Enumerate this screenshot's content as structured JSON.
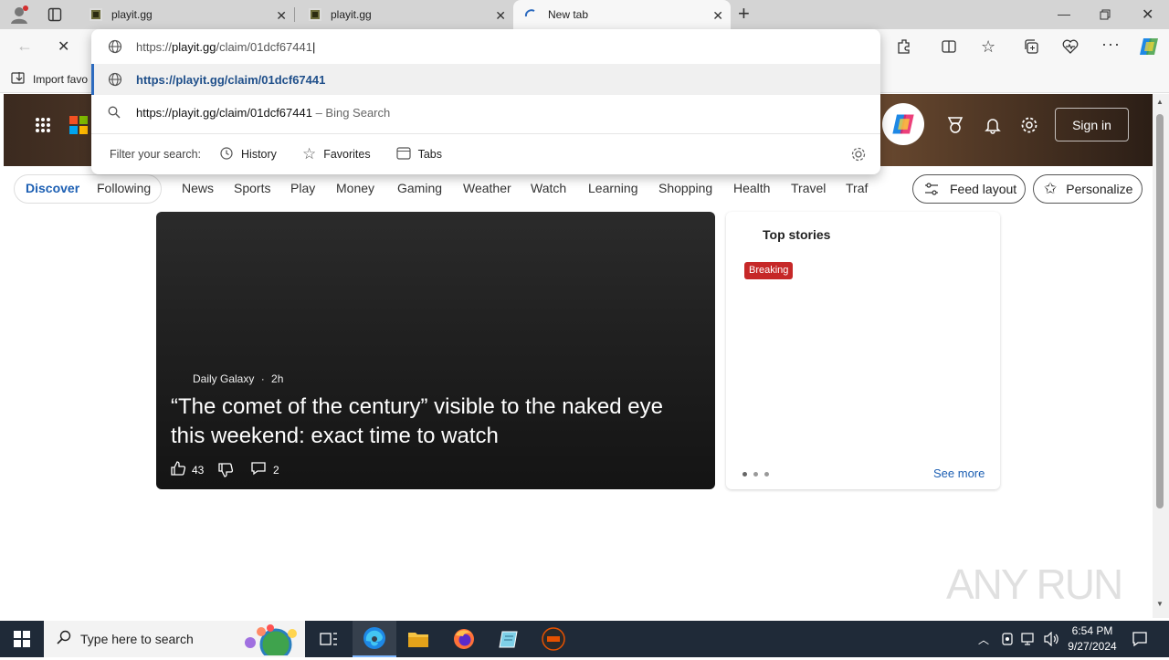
{
  "tabs": [
    {
      "title": "playit.gg"
    },
    {
      "title": "playit.gg"
    },
    {
      "title": "New tab"
    }
  ],
  "address_bar": {
    "value_prefix": "https://",
    "value_host": "playit.gg",
    "value_path": "/claim/01dcf67441"
  },
  "suggestions": [
    {
      "text": "https://playit.gg/claim/01dcf67441",
      "suffix": ""
    },
    {
      "text": "https://playit.gg/claim/01dcf67441",
      "suffix": " – Bing Search"
    }
  ],
  "filter": {
    "label": "Filter your search:",
    "options": [
      "History",
      "Favorites",
      "Tabs"
    ]
  },
  "favorites_bar": {
    "import_label": "Import favo"
  },
  "header": {
    "sign_in": "Sign in"
  },
  "nav": {
    "items": [
      "Discover",
      "Following",
      "News",
      "Sports",
      "Play",
      "Money",
      "Gaming",
      "Weather",
      "Watch",
      "Learning",
      "Shopping",
      "Health",
      "Travel",
      "Traf"
    ],
    "feed_layout": "Feed layout",
    "personalize": "Personalize"
  },
  "main_card": {
    "source": "Daily Galaxy",
    "age": "2h",
    "headline": "“The comet of the century” visible to the naked eye this weekend: exact time to watch",
    "likes": "43",
    "comments": "2"
  },
  "top_stories": {
    "title": "Top stories",
    "badge": "Breaking",
    "see_more": "See more"
  },
  "watermark": "ANY RUN",
  "taskbar": {
    "search_placeholder": "Type here to search",
    "time": "6:54 PM",
    "date": "9/27/2024"
  },
  "colors": {
    "accent": "#2d6bbf",
    "breaking": "#c62828",
    "taskbar": "#1f2a38"
  }
}
